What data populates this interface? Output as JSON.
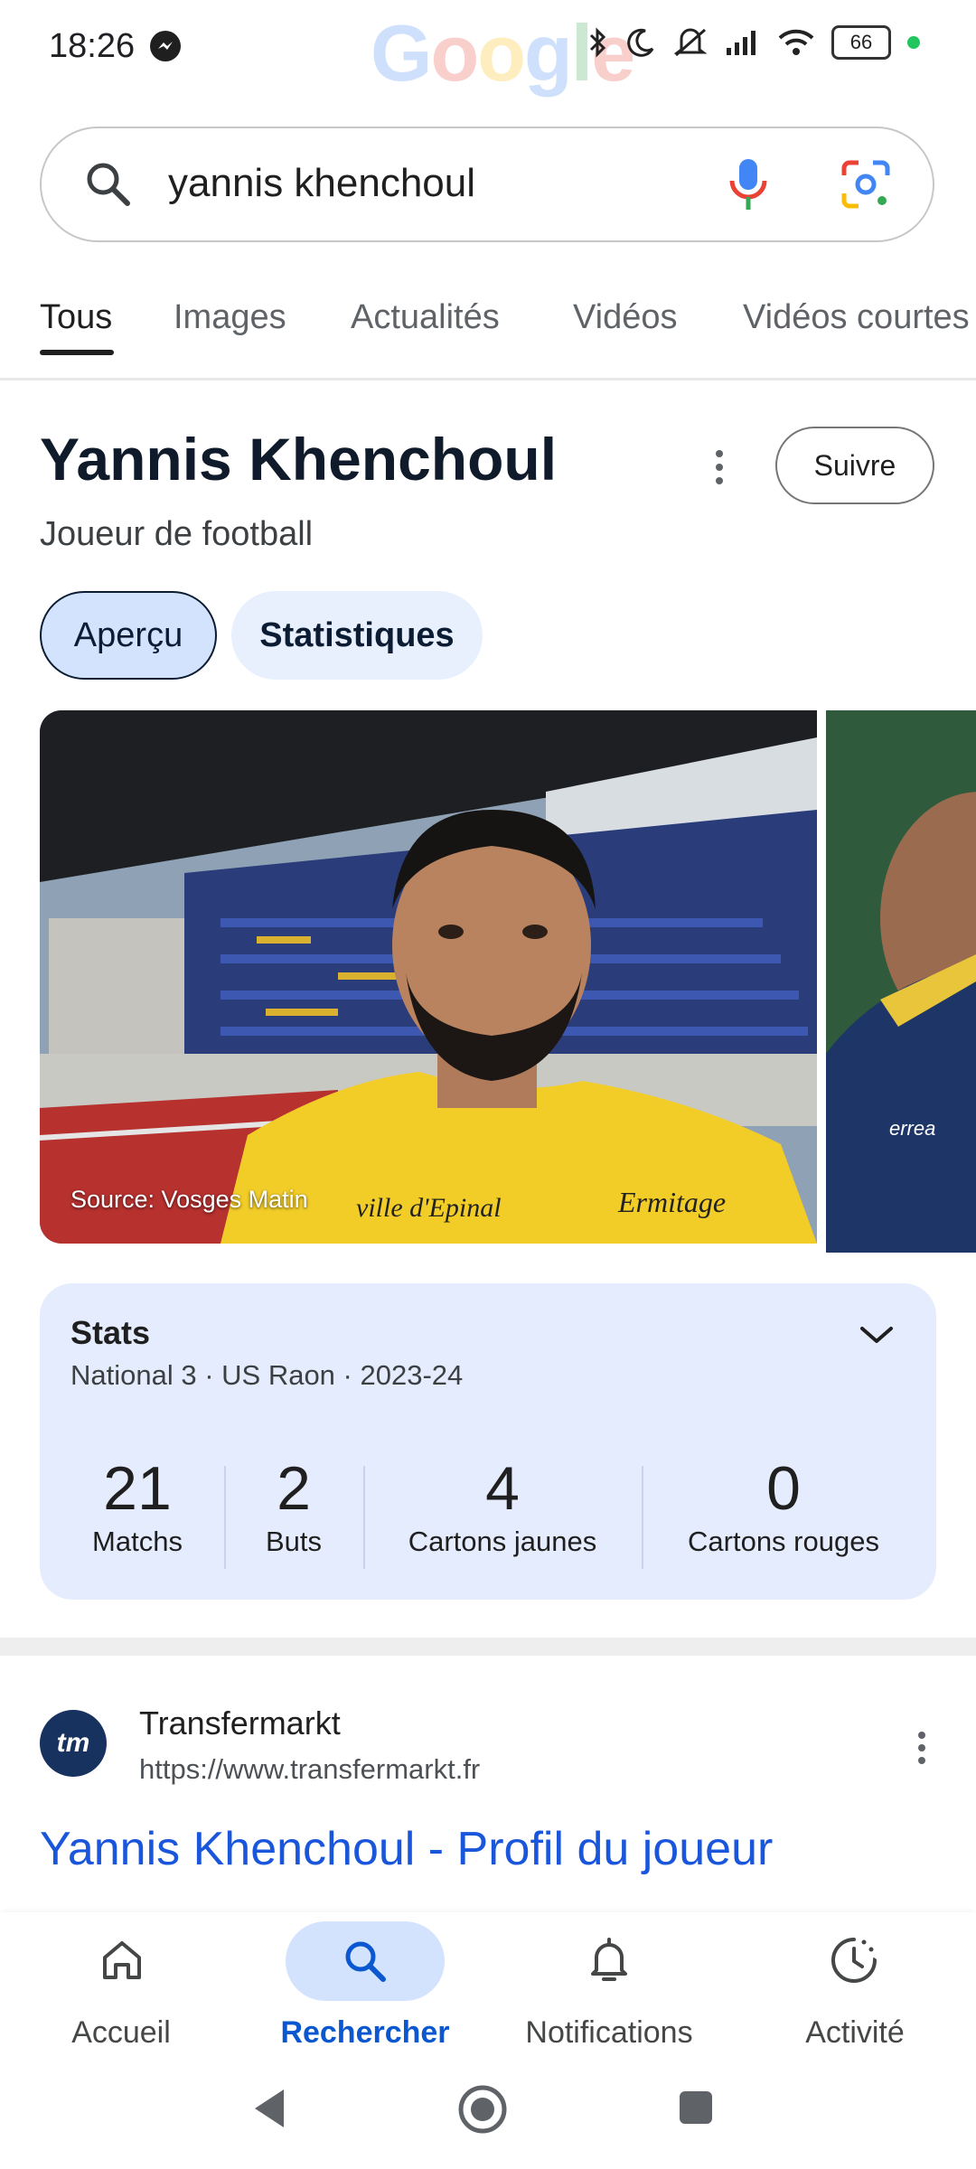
{
  "status_bar": {
    "time": "18:26",
    "battery": "66",
    "watermark": "Google"
  },
  "search": {
    "query": "yannis khenchoul"
  },
  "tabs": [
    {
      "label": "Tous"
    },
    {
      "label": "Images"
    },
    {
      "label": "Actualités"
    },
    {
      "label": "Vidéos"
    },
    {
      "label": "Vidéos courtes"
    }
  ],
  "panel": {
    "title": "Yannis Khenchoul",
    "subtitle": "Joueur de football",
    "follow_label": "Suivre",
    "chips": [
      {
        "label": "Aperçu"
      },
      {
        "label": "Statistiques"
      }
    ],
    "image_source": "Source: Vosges Matin"
  },
  "stats": {
    "title": "Stats",
    "subtitle": "National 3 · US Raon · 2023-24",
    "items": [
      {
        "value": "21",
        "label": "Matchs"
      },
      {
        "value": "2",
        "label": "Buts"
      },
      {
        "value": "4",
        "label": "Cartons jaunes"
      },
      {
        "value": "0",
        "label": "Cartons rouges"
      }
    ]
  },
  "result": {
    "favicon_text": "tm",
    "site": "Transfermarkt",
    "url": "https://www.transfermarkt.fr",
    "title": "Yannis Khenchoul - Profil du joueur"
  },
  "bottom_nav": [
    {
      "label": "Accueil",
      "icon": "home-icon"
    },
    {
      "label": "Rechercher",
      "icon": "search-icon"
    },
    {
      "label": "Notifications",
      "icon": "bell-icon"
    },
    {
      "label": "Activité",
      "icon": "activity-icon"
    }
  ],
  "colors": {
    "accent": "#0b57d0",
    "link": "#1a56db",
    "chip_bg": "#d3e3fd",
    "card_bg": "#e5ecfd"
  }
}
